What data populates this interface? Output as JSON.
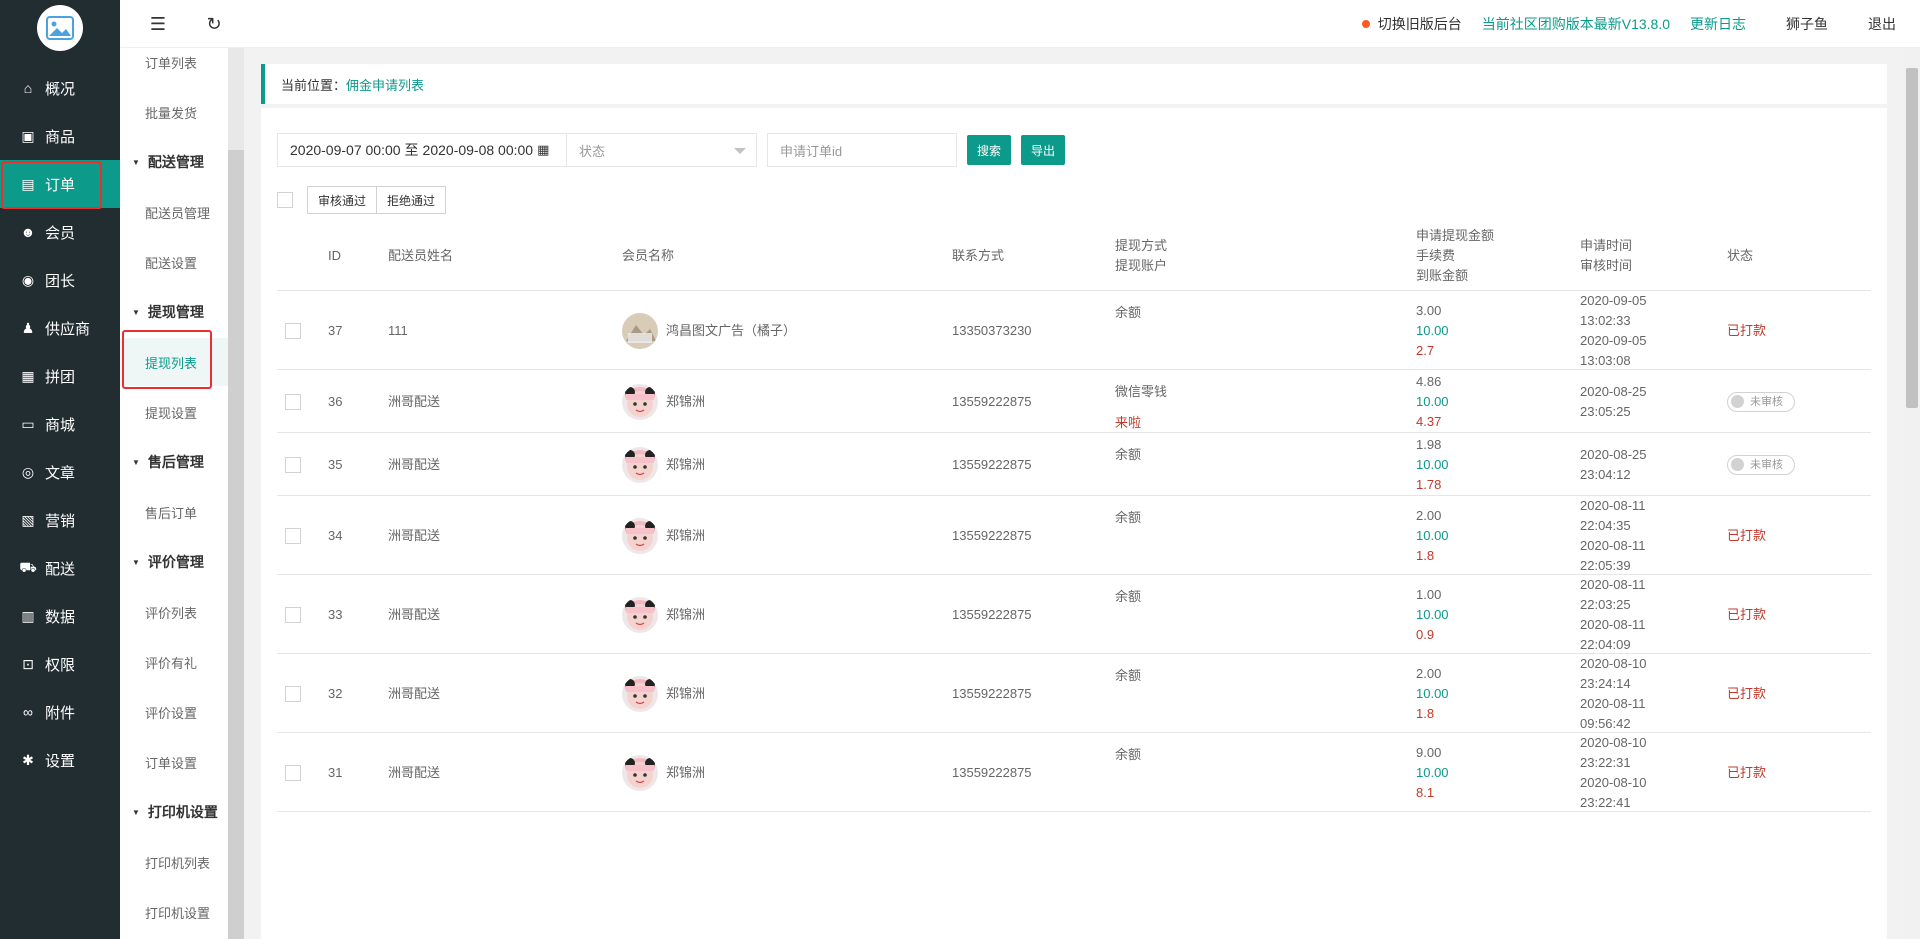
{
  "sidebar": {
    "items": [
      {
        "label": "概况",
        "icon": "home-icon",
        "glyph": "⌂"
      },
      {
        "label": "商品",
        "icon": "goods-icon",
        "glyph": "▣"
      },
      {
        "label": "订单",
        "icon": "order-icon",
        "glyph": "▤"
      },
      {
        "label": "会员",
        "icon": "member-icon",
        "glyph": "☻"
      },
      {
        "label": "团长",
        "icon": "leader-icon",
        "glyph": "◉"
      },
      {
        "label": "供应商",
        "icon": "supplier-icon",
        "glyph": "♟"
      },
      {
        "label": "拼团",
        "icon": "group-icon",
        "glyph": "▦"
      },
      {
        "label": "商城",
        "icon": "mall-icon",
        "glyph": "▭"
      },
      {
        "label": "文章",
        "icon": "article-icon",
        "glyph": "◎"
      },
      {
        "label": "营销",
        "icon": "marketing-icon",
        "glyph": "▧"
      },
      {
        "label": "配送",
        "icon": "delivery-icon",
        "glyph": "⛟"
      },
      {
        "label": "数据",
        "icon": "data-icon",
        "glyph": "▥"
      },
      {
        "label": "权限",
        "icon": "lock-icon",
        "glyph": "⊡"
      },
      {
        "label": "附件",
        "icon": "attachment-icon",
        "glyph": "∞"
      },
      {
        "label": "设置",
        "icon": "gear-icon",
        "glyph": "✱"
      }
    ]
  },
  "subnav": {
    "order_list": "订单列表",
    "batch_ship": "批量发货",
    "delivery_group": "配送管理",
    "courier_manage": "配送员管理",
    "delivery_settings": "配送设置",
    "withdraw_group": "提现管理",
    "withdraw_list": "提现列表",
    "withdraw_settings": "提现设置",
    "aftersale_group": "售后管理",
    "aftersale_orders": "售后订单",
    "review_group": "评价管理",
    "review_list": "评价列表",
    "review_gift": "评价有礼",
    "review_settings": "评价设置",
    "order_settings": "订单设置",
    "printer_group": "打印机设置",
    "printer_list": "打印机列表",
    "printer_settings": "打印机设置"
  },
  "topbar": {
    "switch_old": "切换旧版后台",
    "version": "当前社区团购版本最新V13.8.0",
    "changelog": "更新日志",
    "username": "狮子鱼",
    "logout": "退出"
  },
  "breadcrumb": {
    "prefix": "当前位置：",
    "current": "佣金申请列表"
  },
  "filter": {
    "date_start": "2020-09-07 00:00",
    "date_sep": "至",
    "date_end": "2020-09-08 00:00",
    "status_placeholder": "状态",
    "order_id_placeholder": "申请订单id",
    "search_label": "搜索",
    "export_label": "导出"
  },
  "bulk": {
    "approve": "审核通过",
    "reject": "拒绝通过"
  },
  "table": {
    "headers": {
      "id": "ID",
      "courier": "配送员姓名",
      "member": "会员名称",
      "contact": "联系方式",
      "method": "提现方式",
      "account": "提现账户",
      "apply_amount": "申请提现金额",
      "fee": "手续费",
      "received": "到账金额",
      "apply_time": "申请时间",
      "audit_time": "审核时间",
      "status": "状态"
    },
    "rows": [
      {
        "id": "37",
        "courier": "111",
        "member": "鸿昌图文广告（橘子）",
        "contact": "13350373230",
        "method": "余额",
        "account": "",
        "amount": "3.00",
        "fee": "10.00",
        "received": "2.7",
        "apply_date": "2020-09-05",
        "apply_clock": "13:02:33",
        "audit_date": "2020-09-05",
        "audit_clock": "13:03:08",
        "status": "已打款"
      },
      {
        "id": "36",
        "courier": "洲哥配送",
        "member": "郑锦洲",
        "contact": "13559222875",
        "method": "微信零钱",
        "account": "来啦",
        "amount": "4.86",
        "fee": "10.00",
        "received": "4.37",
        "apply_date": "2020-08-25",
        "apply_clock": "23:05:25",
        "audit_date": "",
        "audit_clock": "",
        "status": "未审核"
      },
      {
        "id": "35",
        "courier": "洲哥配送",
        "member": "郑锦洲",
        "contact": "13559222875",
        "method": "余额",
        "account": "",
        "amount": "1.98",
        "fee": "10.00",
        "received": "1.78",
        "apply_date": "2020-08-25",
        "apply_clock": "23:04:12",
        "audit_date": "",
        "audit_clock": "",
        "status": "未审核"
      },
      {
        "id": "34",
        "courier": "洲哥配送",
        "member": "郑锦洲",
        "contact": "13559222875",
        "method": "余额",
        "account": "",
        "amount": "2.00",
        "fee": "10.00",
        "received": "1.8",
        "apply_date": "2020-08-11",
        "apply_clock": "22:04:35",
        "audit_date": "2020-08-11",
        "audit_clock": "22:05:39",
        "status": "已打款"
      },
      {
        "id": "33",
        "courier": "洲哥配送",
        "member": "郑锦洲",
        "contact": "13559222875",
        "method": "余额",
        "account": "",
        "amount": "1.00",
        "fee": "10.00",
        "received": "0.9",
        "apply_date": "2020-08-11",
        "apply_clock": "22:03:25",
        "audit_date": "2020-08-11",
        "audit_clock": "22:04:09",
        "status": "已打款"
      },
      {
        "id": "32",
        "courier": "洲哥配送",
        "member": "郑锦洲",
        "contact": "13559222875",
        "method": "余额",
        "account": "",
        "amount": "2.00",
        "fee": "10.00",
        "received": "1.8",
        "apply_date": "2020-08-10",
        "apply_clock": "23:24:14",
        "audit_date": "2020-08-11",
        "audit_clock": "09:56:42",
        "status": "已打款"
      },
      {
        "id": "31",
        "courier": "洲哥配送",
        "member": "郑锦洲",
        "contact": "13559222875",
        "method": "余额",
        "account": "",
        "amount": "9.00",
        "fee": "10.00",
        "received": "8.1",
        "apply_date": "2020-08-10",
        "apply_clock": "23:22:31",
        "audit_date": "2020-08-10",
        "audit_clock": "23:22:41",
        "status": "已打款"
      }
    ]
  },
  "colors": {
    "accent": "#0c9a8a",
    "sidebar": "#222d32",
    "paid": "#c0392b",
    "highlight": "#e8312f"
  }
}
